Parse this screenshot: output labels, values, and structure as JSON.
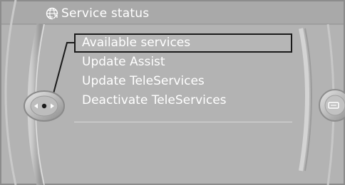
{
  "screen": {
    "title": "Service status",
    "title_icon": "service-globe-icon"
  },
  "menu": {
    "items": [
      {
        "label": "Available services",
        "selected": true
      },
      {
        "label": "Update Assist",
        "selected": false
      },
      {
        "label": "Update TeleServices",
        "selected": false
      },
      {
        "label": "Deactivate TeleServices",
        "selected": false
      }
    ]
  },
  "controller": {
    "icon": "idrive-controller-icon"
  },
  "right_knob": {
    "icon": "options-icon"
  },
  "colors": {
    "background": "#b3b3b3",
    "text": "#ffffff",
    "highlight_border": "#1a1a1a"
  }
}
